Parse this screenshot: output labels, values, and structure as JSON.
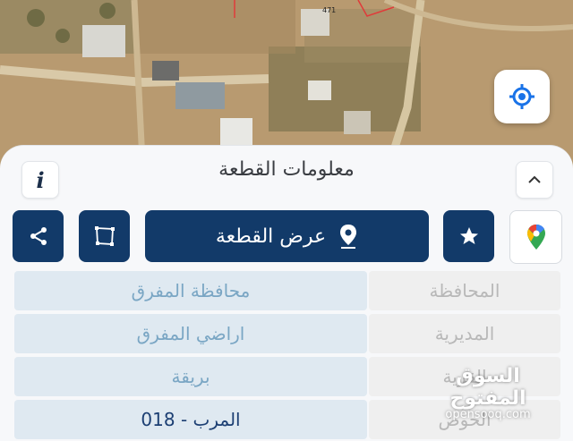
{
  "map": {
    "road_label": "471",
    "locate_icon": "crosshair-icon"
  },
  "sheet": {
    "title": "معلومات القطعة",
    "info_icon_label": "i",
    "collapse_icon": "chevron-up-icon"
  },
  "actions": {
    "show_plot_label": "عرض القطعة",
    "share_icon": "share-icon",
    "polygon_icon": "polygon-icon",
    "pin_icon": "location-pin-icon",
    "favorite_icon": "star-icon",
    "google_maps_icon": "google-maps-icon"
  },
  "details": [
    {
      "label": "المحافظة",
      "value": "محافظة المفرق"
    },
    {
      "label": "المديرية",
      "value": "اراضي المفرق"
    },
    {
      "label": "القرية",
      "value": "بريقة"
    },
    {
      "label": "الحوض",
      "value": "المرب - 018"
    }
  ],
  "watermark": {
    "arabic": "السوق المفتوح",
    "english": "opensooq.com"
  },
  "colors": {
    "primary": "#123a69",
    "value_bg": "#dfe9f1",
    "label_bg": "#efefef",
    "accent_blue": "#1a73e8"
  }
}
